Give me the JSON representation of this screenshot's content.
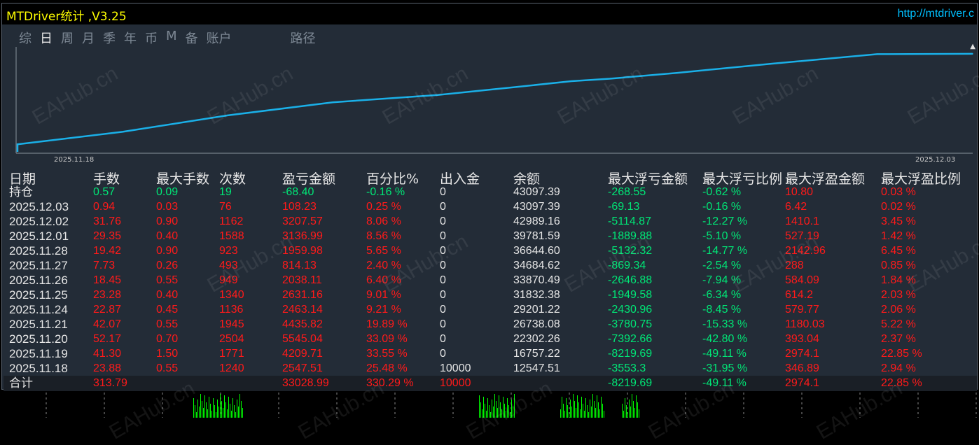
{
  "window": {
    "title": "MTDriver统计 ,V3.25",
    "url": "http://mtdriver.c"
  },
  "tabs": [
    {
      "label": "综"
    },
    {
      "label": "日",
      "active": true
    },
    {
      "label": "周"
    },
    {
      "label": "月"
    },
    {
      "label": "季"
    },
    {
      "label": "年"
    },
    {
      "label": "币"
    },
    {
      "label": "M"
    },
    {
      "label": "备"
    },
    {
      "label": "账户"
    },
    {
      "label": "路径"
    }
  ],
  "chart_data": {
    "type": "line",
    "title": "",
    "x_start_label": "2025.11.18",
    "x_end_label": "2025.12.03",
    "x": [
      "2025.11.18",
      "2025.11.19",
      "2025.11.20",
      "2025.11.21",
      "2025.11.24",
      "2025.11.25",
      "2025.11.26",
      "2025.11.27",
      "2025.11.28",
      "2025.12.01",
      "2025.12.02",
      "2025.12.03"
    ],
    "series": [
      {
        "values": [
          12547.51,
          16757.22,
          22302.26,
          26738.08,
          29201.22,
          31832.38,
          33870.49,
          34684.62,
          36644.6,
          39781.59,
          42989.16,
          43097.39
        ]
      }
    ],
    "color": "#1ab0e8"
  },
  "table": {
    "headers": [
      "日期",
      "手数",
      "最大手数",
      "次数",
      "盈亏金额",
      "百分比%",
      "出入金",
      "余额",
      "最大浮亏金额",
      "最大浮亏比例",
      "最大浮盈金额",
      "最大浮盈比例"
    ],
    "holding": {
      "date": "持仓",
      "lots": "0.57",
      "max_lots": "0.09",
      "count": "19",
      "pnl": "-68.40",
      "pct": "-0.16 %",
      "io": "0",
      "balance": "43097.39",
      "max_dd": "-268.55",
      "max_dd_pct": "-0.62 %",
      "max_fp": "10.80",
      "max_fp_pct": "0.03 %"
    },
    "rows": [
      {
        "date": "2025.12.03",
        "lots": "0.94",
        "max_lots": "0.03",
        "count": "76",
        "pnl": "108.23",
        "pct": "0.25 %",
        "io": "0",
        "balance": "43097.39",
        "max_dd": "-69.13",
        "max_dd_pct": "-0.16 %",
        "max_fp": "6.42",
        "max_fp_pct": "0.02 %"
      },
      {
        "date": "2025.12.02",
        "lots": "31.76",
        "max_lots": "0.90",
        "count": "1162",
        "pnl": "3207.57",
        "pct": "8.06 %",
        "io": "0",
        "balance": "42989.16",
        "max_dd": "-5114.87",
        "max_dd_pct": "-12.27 %",
        "max_fp": "1410.1",
        "max_fp_pct": "3.45 %"
      },
      {
        "date": "2025.12.01",
        "lots": "29.35",
        "max_lots": "0.40",
        "count": "1588",
        "pnl": "3136.99",
        "pct": "8.56 %",
        "io": "0",
        "balance": "39781.59",
        "max_dd": "-1889.88",
        "max_dd_pct": "-5.10 %",
        "max_fp": "527.19",
        "max_fp_pct": "1.42 %"
      },
      {
        "date": "2025.11.28",
        "lots": "19.42",
        "max_lots": "0.90",
        "count": "923",
        "pnl": "1959.98",
        "pct": "5.65 %",
        "io": "0",
        "balance": "36644.60",
        "max_dd": "-5132.32",
        "max_dd_pct": "-14.77 %",
        "max_fp": "2142.96",
        "max_fp_pct": "6.45 %"
      },
      {
        "date": "2025.11.27",
        "lots": "7.73",
        "max_lots": "0.26",
        "count": "493",
        "pnl": "814.13",
        "pct": "2.40 %",
        "io": "0",
        "balance": "34684.62",
        "max_dd": "-869.34",
        "max_dd_pct": "-2.54 %",
        "max_fp": "288",
        "max_fp_pct": "0.85 %"
      },
      {
        "date": "2025.11.26",
        "lots": "18.45",
        "max_lots": "0.55",
        "count": "949",
        "pnl": "2038.11",
        "pct": "6.40 %",
        "io": "0",
        "balance": "33870.49",
        "max_dd": "-2646.88",
        "max_dd_pct": "-7.94 %",
        "max_fp": "584.09",
        "max_fp_pct": "1.84 %"
      },
      {
        "date": "2025.11.25",
        "lots": "23.28",
        "max_lots": "0.40",
        "count": "1340",
        "pnl": "2631.16",
        "pct": "9.01 %",
        "io": "0",
        "balance": "31832.38",
        "max_dd": "-1949.58",
        "max_dd_pct": "-6.34 %",
        "max_fp": "614.2",
        "max_fp_pct": "2.03 %"
      },
      {
        "date": "2025.11.24",
        "lots": "22.87",
        "max_lots": "0.45",
        "count": "1136",
        "pnl": "2463.14",
        "pct": "9.21 %",
        "io": "0",
        "balance": "29201.22",
        "max_dd": "-2430.96",
        "max_dd_pct": "-8.45 %",
        "max_fp": "579.77",
        "max_fp_pct": "2.06 %"
      },
      {
        "date": "2025.11.21",
        "lots": "42.07",
        "max_lots": "0.55",
        "count": "1945",
        "pnl": "4435.82",
        "pct": "19.89 %",
        "io": "0",
        "balance": "26738.08",
        "max_dd": "-3780.75",
        "max_dd_pct": "-15.33 %",
        "max_fp": "1180.03",
        "max_fp_pct": "5.22 %"
      },
      {
        "date": "2025.11.20",
        "lots": "52.17",
        "max_lots": "0.70",
        "count": "2504",
        "pnl": "5545.04",
        "pct": "33.09 %",
        "io": "0",
        "balance": "22302.26",
        "max_dd": "-7392.66",
        "max_dd_pct": "-42.80 %",
        "max_fp": "393.04",
        "max_fp_pct": "2.37 %"
      },
      {
        "date": "2025.11.19",
        "lots": "41.30",
        "max_lots": "1.50",
        "count": "1771",
        "pnl": "4209.71",
        "pct": "33.55 %",
        "io": "0",
        "balance": "16757.22",
        "max_dd": "-8219.69",
        "max_dd_pct": "-49.11 %",
        "max_fp": "2974.1",
        "max_fp_pct": "22.85 %"
      },
      {
        "date": "2025.11.18",
        "lots": "23.88",
        "max_lots": "0.55",
        "count": "1240",
        "pnl": "2547.51",
        "pct": "25.48 %",
        "io": "10000",
        "balance": "12547.51",
        "max_dd": "-3553.3",
        "max_dd_pct": "-31.95 %",
        "max_fp": "346.89",
        "max_fp_pct": "2.94 %"
      }
    ],
    "total": {
      "label": "合计",
      "lots": "313.79",
      "pnl": "33028.99",
      "pct": "330.29 %",
      "io": "10000",
      "max_dd": "-8219.69",
      "max_dd_pct": "-49.11 %",
      "max_fp": "2974.1",
      "max_fp_pct": "22.85 %"
    }
  },
  "watermark": "EAHub.cn",
  "colors": {
    "positive": "#00e676",
    "negative": "#ff1a1a",
    "line": "#1ab0e8",
    "title": "#ffff00",
    "url": "#00c0ff"
  }
}
